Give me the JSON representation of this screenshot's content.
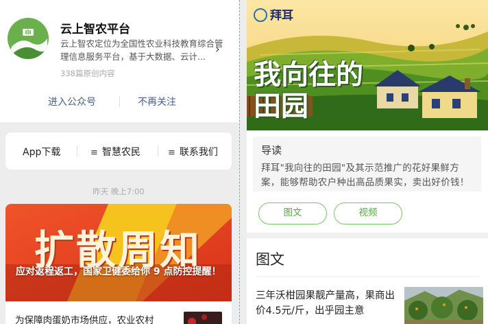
{
  "left": {
    "account": {
      "name": "云上智农平台",
      "description": "云上智农定位为全国性农业科技教育综合管理信息服务平台，基于大数据、云计...",
      "article_count": "338篇原创内容",
      "enter_label": "进入公众号",
      "unfollow_label": "不再关注",
      "logo_icon": "farm-logo-icon",
      "brand_color": "#6ab04c"
    },
    "menu": {
      "app_label": "App下载",
      "farm_label": "智慧农民",
      "contact_label": "联系我们"
    },
    "timestamp": "昨天 晚上7:00",
    "article": {
      "banner_title": "扩散周知",
      "banner_caption": "应对返程返工，国家卫健委给你 9 点防控提醒！",
      "subtitle": "为保障肉蛋奶市场供应，农业农村"
    }
  },
  "right": {
    "brand": "拜耳",
    "hero_title_line1": "我向往的",
    "hero_title_line2": "田园",
    "guide": {
      "heading": "导读",
      "body": "拜耳\"我向往的田园\"及其示范推广的花好果鲜方案，能够帮助农户种出高品质果实，卖出好价钱！"
    },
    "tags": {
      "picture_label": "图文",
      "video_label": "视频",
      "accent_color": "#7cc26a"
    },
    "section_title": "图文",
    "post": {
      "title": "三年沃柑园果靓产量高，果商出价4.5元/斤，出乎园主意"
    }
  }
}
